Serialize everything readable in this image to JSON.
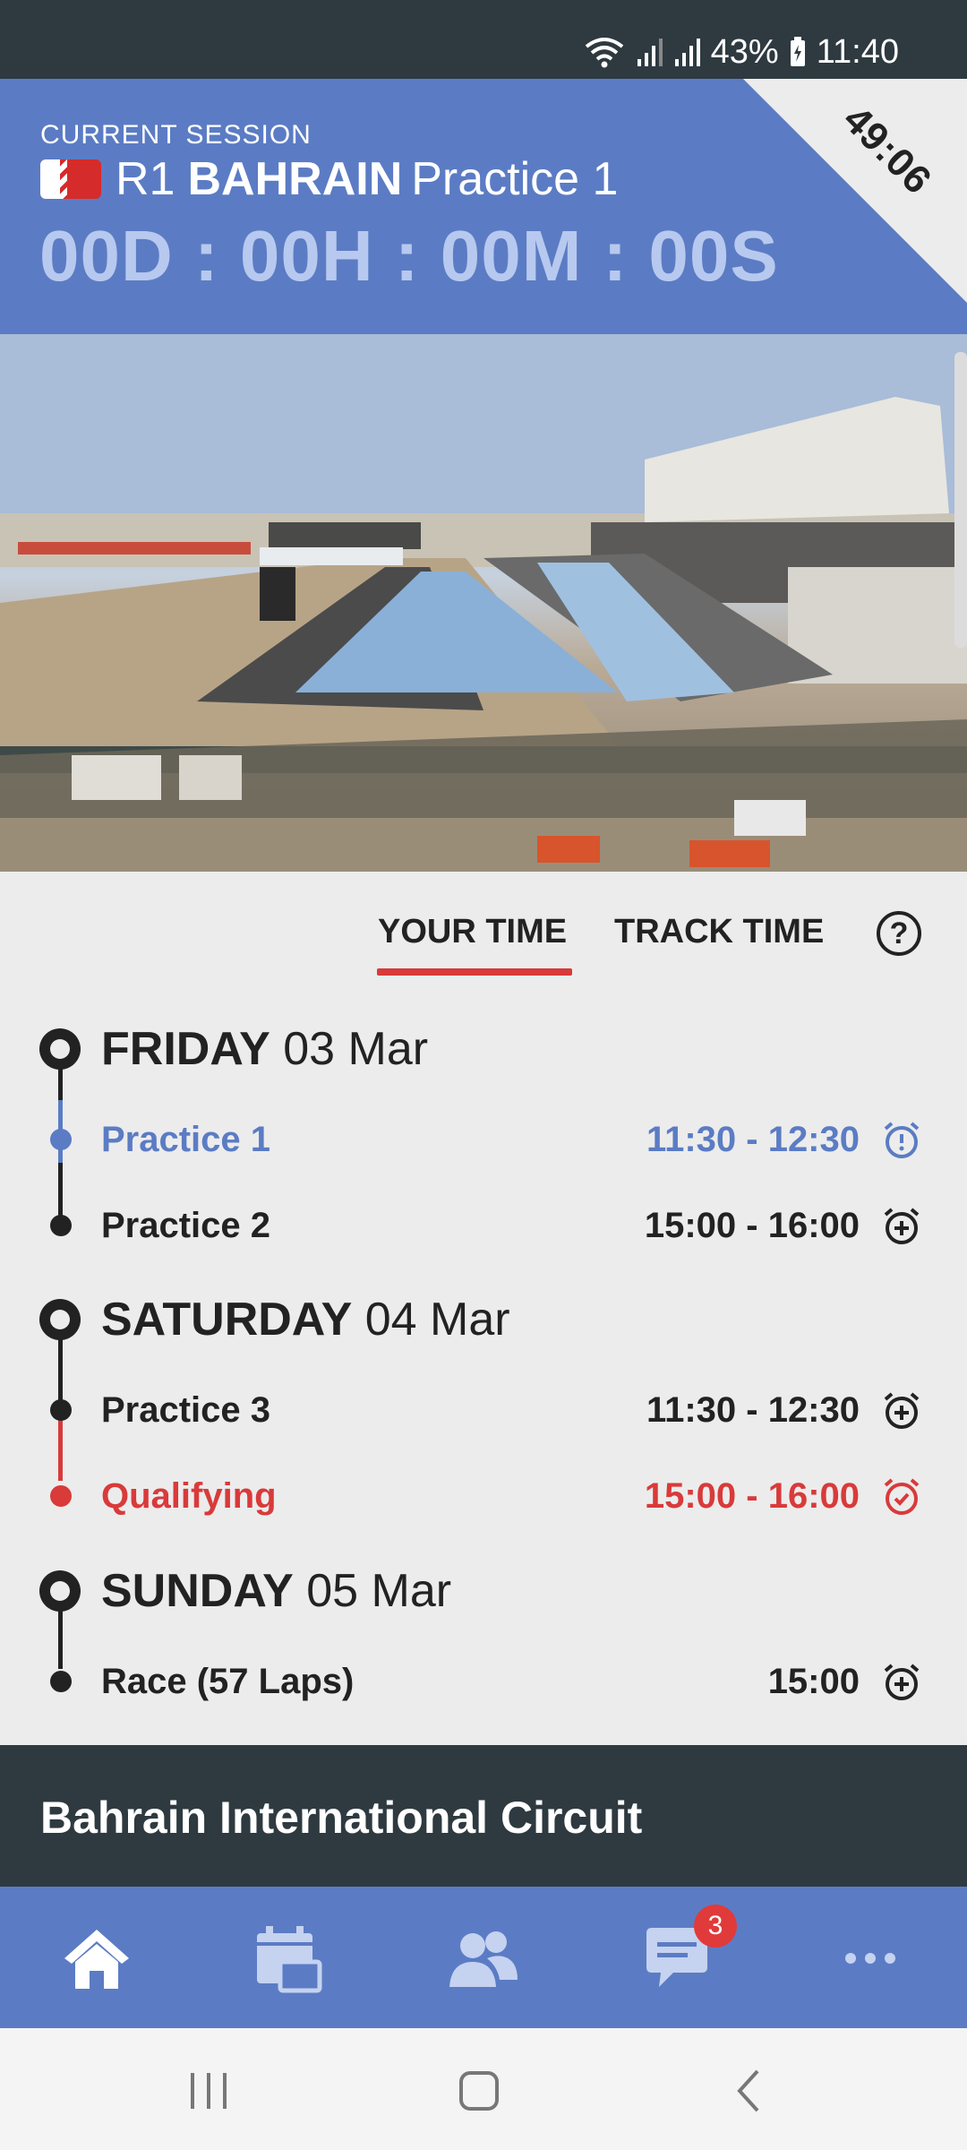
{
  "status_bar": {
    "battery": "43%",
    "time": "11:40"
  },
  "header": {
    "label": "CURRENT SESSION",
    "round": "R1",
    "country": "BAHRAIN",
    "session": "Practice 1",
    "countdown": "00D : 00H : 00M : 00S",
    "corner_timer": "49:06",
    "accent": "#5b7cc4"
  },
  "tabs": {
    "your_time": "YOUR TIME",
    "track_time": "TRACK TIME",
    "help": "?"
  },
  "schedule": [
    {
      "day": "FRIDAY",
      "date": "03 Mar",
      "sessions": [
        {
          "name": "Practice 1",
          "time": "11:30 - 12:30",
          "state": "current"
        },
        {
          "name": "Practice 2",
          "time": "15:00 - 16:00",
          "state": "normal"
        }
      ]
    },
    {
      "day": "SATURDAY",
      "date": "04 Mar",
      "sessions": [
        {
          "name": "Practice 3",
          "time": "11:30 - 12:30",
          "state": "normal"
        },
        {
          "name": "Qualifying",
          "time": "15:00 - 16:00",
          "state": "alarm"
        }
      ]
    },
    {
      "day": "SUNDAY",
      "date": "05 Mar",
      "sessions": [
        {
          "name": "Race (57 Laps)",
          "time": "15:00",
          "state": "normal"
        }
      ]
    }
  ],
  "circuit": {
    "name": "Bahrain International Circuit"
  },
  "bottom_nav": {
    "items": [
      "home-icon",
      "calendar-icon",
      "people-icon",
      "chat-icon",
      "more-icon"
    ],
    "chat_badge": "3"
  },
  "colors": {
    "blue": "#5b7cc4",
    "red": "#d93a3a",
    "dark": "#2e3a40"
  }
}
